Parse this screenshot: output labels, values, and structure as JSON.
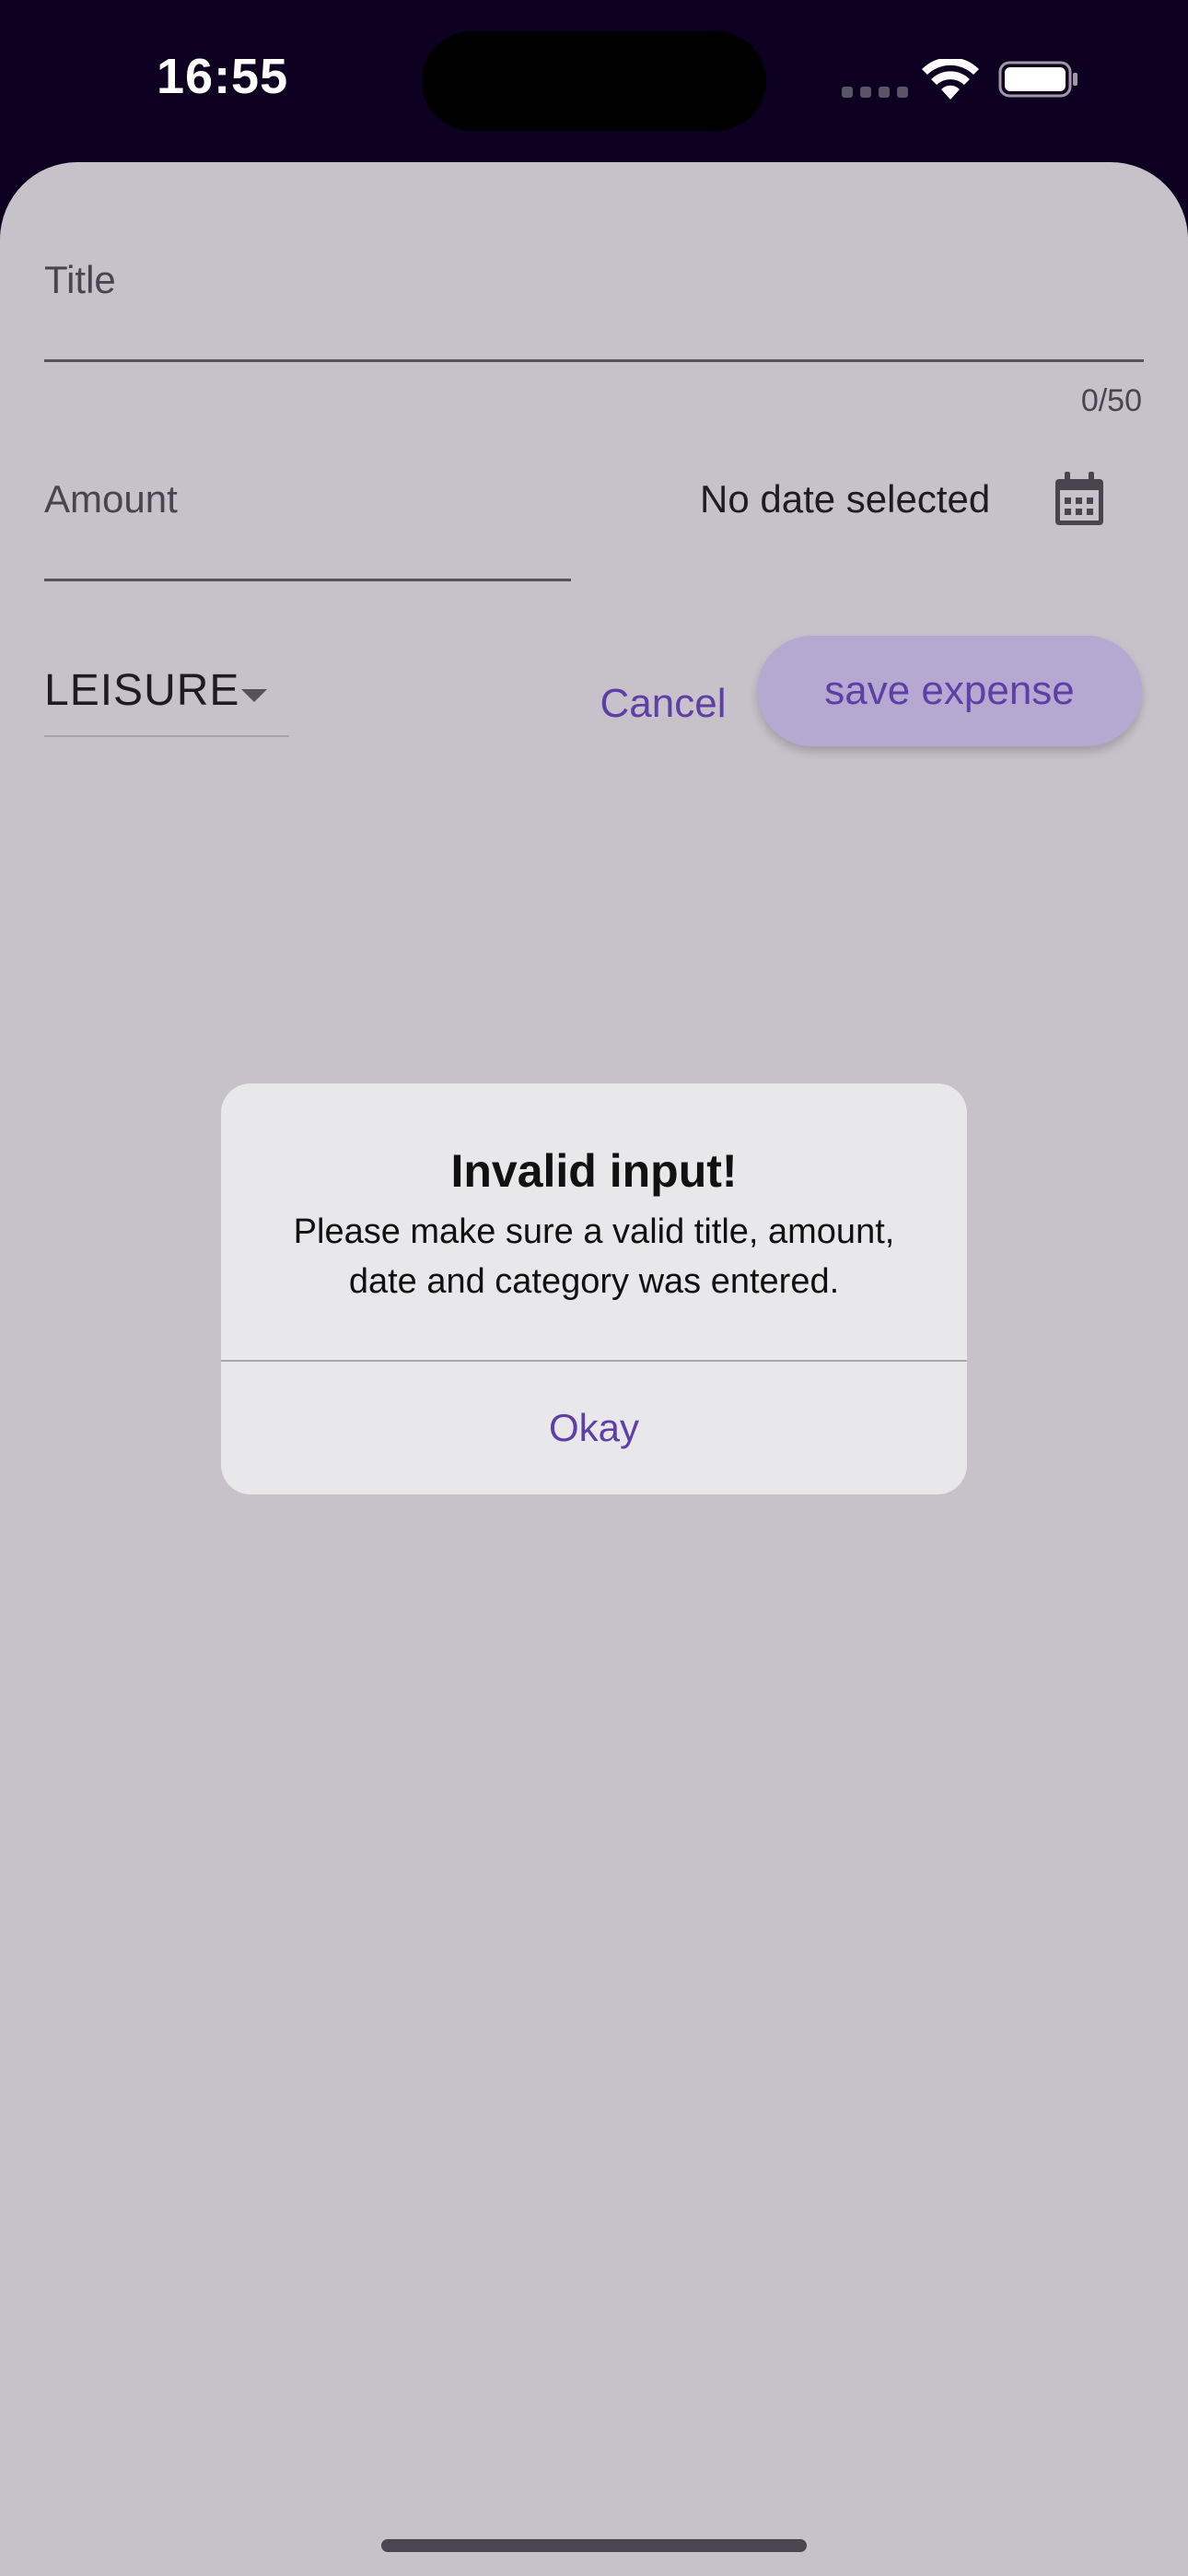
{
  "status_bar": {
    "time": "16:55"
  },
  "form": {
    "title_label": "Title",
    "title_counter": "0/50",
    "amount_label": "Amount",
    "date_text": "No date selected",
    "category_value": "LEISURE",
    "cancel_label": "Cancel",
    "save_label": "save expense"
  },
  "alert": {
    "title": "Invalid input!",
    "message": "Please make sure a valid title, amount, date and category was entered.",
    "okay_label": "Okay"
  },
  "colors": {
    "accent": "#5d3fa6",
    "sheet_background": "#c7c1c9",
    "dialog_background": "#e8e7ea",
    "status_bar_background": "#0d0020"
  },
  "icons": {
    "calendar": "calendar-icon",
    "dropdown": "chevron-down-icon",
    "wifi": "wifi-icon",
    "battery": "battery-icon",
    "signal": "signal-icon"
  }
}
